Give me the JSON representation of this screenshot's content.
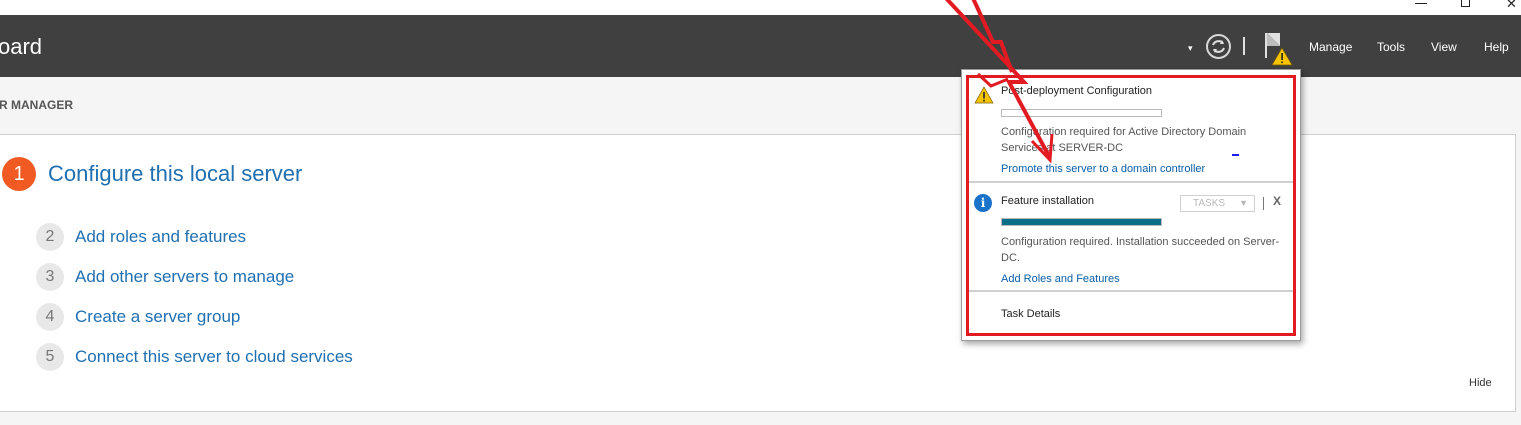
{
  "window": {
    "minimize_icon": "minimize-icon",
    "maximize_icon": "maximize-icon",
    "close_glyph": "✕"
  },
  "header": {
    "title": "oard",
    "caret": "▾",
    "menu": [
      "Manage",
      "Tools",
      "View",
      "Help"
    ],
    "icons": [
      "refresh-icon",
      "notification-flag-icon",
      "warning-icon"
    ]
  },
  "section_title": "R MANAGER",
  "quick_start": {
    "step1": {
      "number": "1",
      "label": "Configure this local server"
    },
    "steps": [
      {
        "number": "2",
        "label": "Add roles and features"
      },
      {
        "number": "3",
        "label": "Add other servers to manage"
      },
      {
        "number": "4",
        "label": "Create a server group"
      },
      {
        "number": "5",
        "label": "Connect this server to cloud services"
      }
    ],
    "hide_label": "Hide"
  },
  "notifications": {
    "items": [
      {
        "title": "Post-deployment Configuration",
        "progress": 0,
        "description": "Configuration required for Active Directory Domain Services at SERVER-DC",
        "link": "Promote this server to a domain controller",
        "icon": "warning-icon"
      },
      {
        "title": "Feature installation",
        "progress": 1.0,
        "tasks_label": "TASKS",
        "close_label": "X",
        "description": "Configuration required. Installation succeeded on Server-DC.",
        "link": "Add Roles and Features",
        "icon": "info-icon"
      }
    ],
    "task_details": "Task Details"
  },
  "colors": {
    "header_bg": "#404040",
    "accent_orange": "#f15a22",
    "link_blue": "#1f6fb1",
    "progress_teal": "#0a6e88",
    "annotation_red": "#e21b23"
  }
}
